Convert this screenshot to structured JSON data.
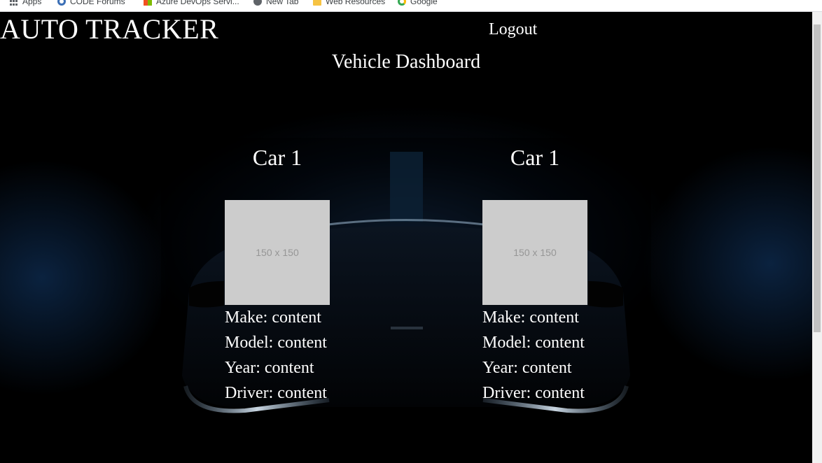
{
  "bookmarks": [
    {
      "label": "Apps",
      "icon": "apps-grid-icon"
    },
    {
      "label": "CODE Forums",
      "icon": "gear-icon"
    },
    {
      "label": "Azure DevOps Servi...",
      "icon": "windows-icon"
    },
    {
      "label": "New Tab",
      "icon": "globe-icon"
    },
    {
      "label": "Web Resources",
      "icon": "folder-icon"
    },
    {
      "label": "Google",
      "icon": "google-icon"
    }
  ],
  "header": {
    "brand": "AUTO TRACKER",
    "logout_label": "Logout",
    "page_title": "Vehicle Dashboard"
  },
  "cars": [
    {
      "title": "Car 1",
      "image_placeholder": "150 x 150",
      "fields": [
        "Make: content",
        "Model: content",
        "Year: content",
        "Driver: content"
      ]
    },
    {
      "title": "Car 1",
      "image_placeholder": "150 x 150",
      "fields": [
        "Make: content",
        "Model: content",
        "Year: content",
        "Driver: content"
      ]
    }
  ],
  "colors": {
    "background": "#000000",
    "text": "#ffffff",
    "placeholder_fill": "#cccccc",
    "placeholder_text": "#969696",
    "glow": "#14324f"
  }
}
